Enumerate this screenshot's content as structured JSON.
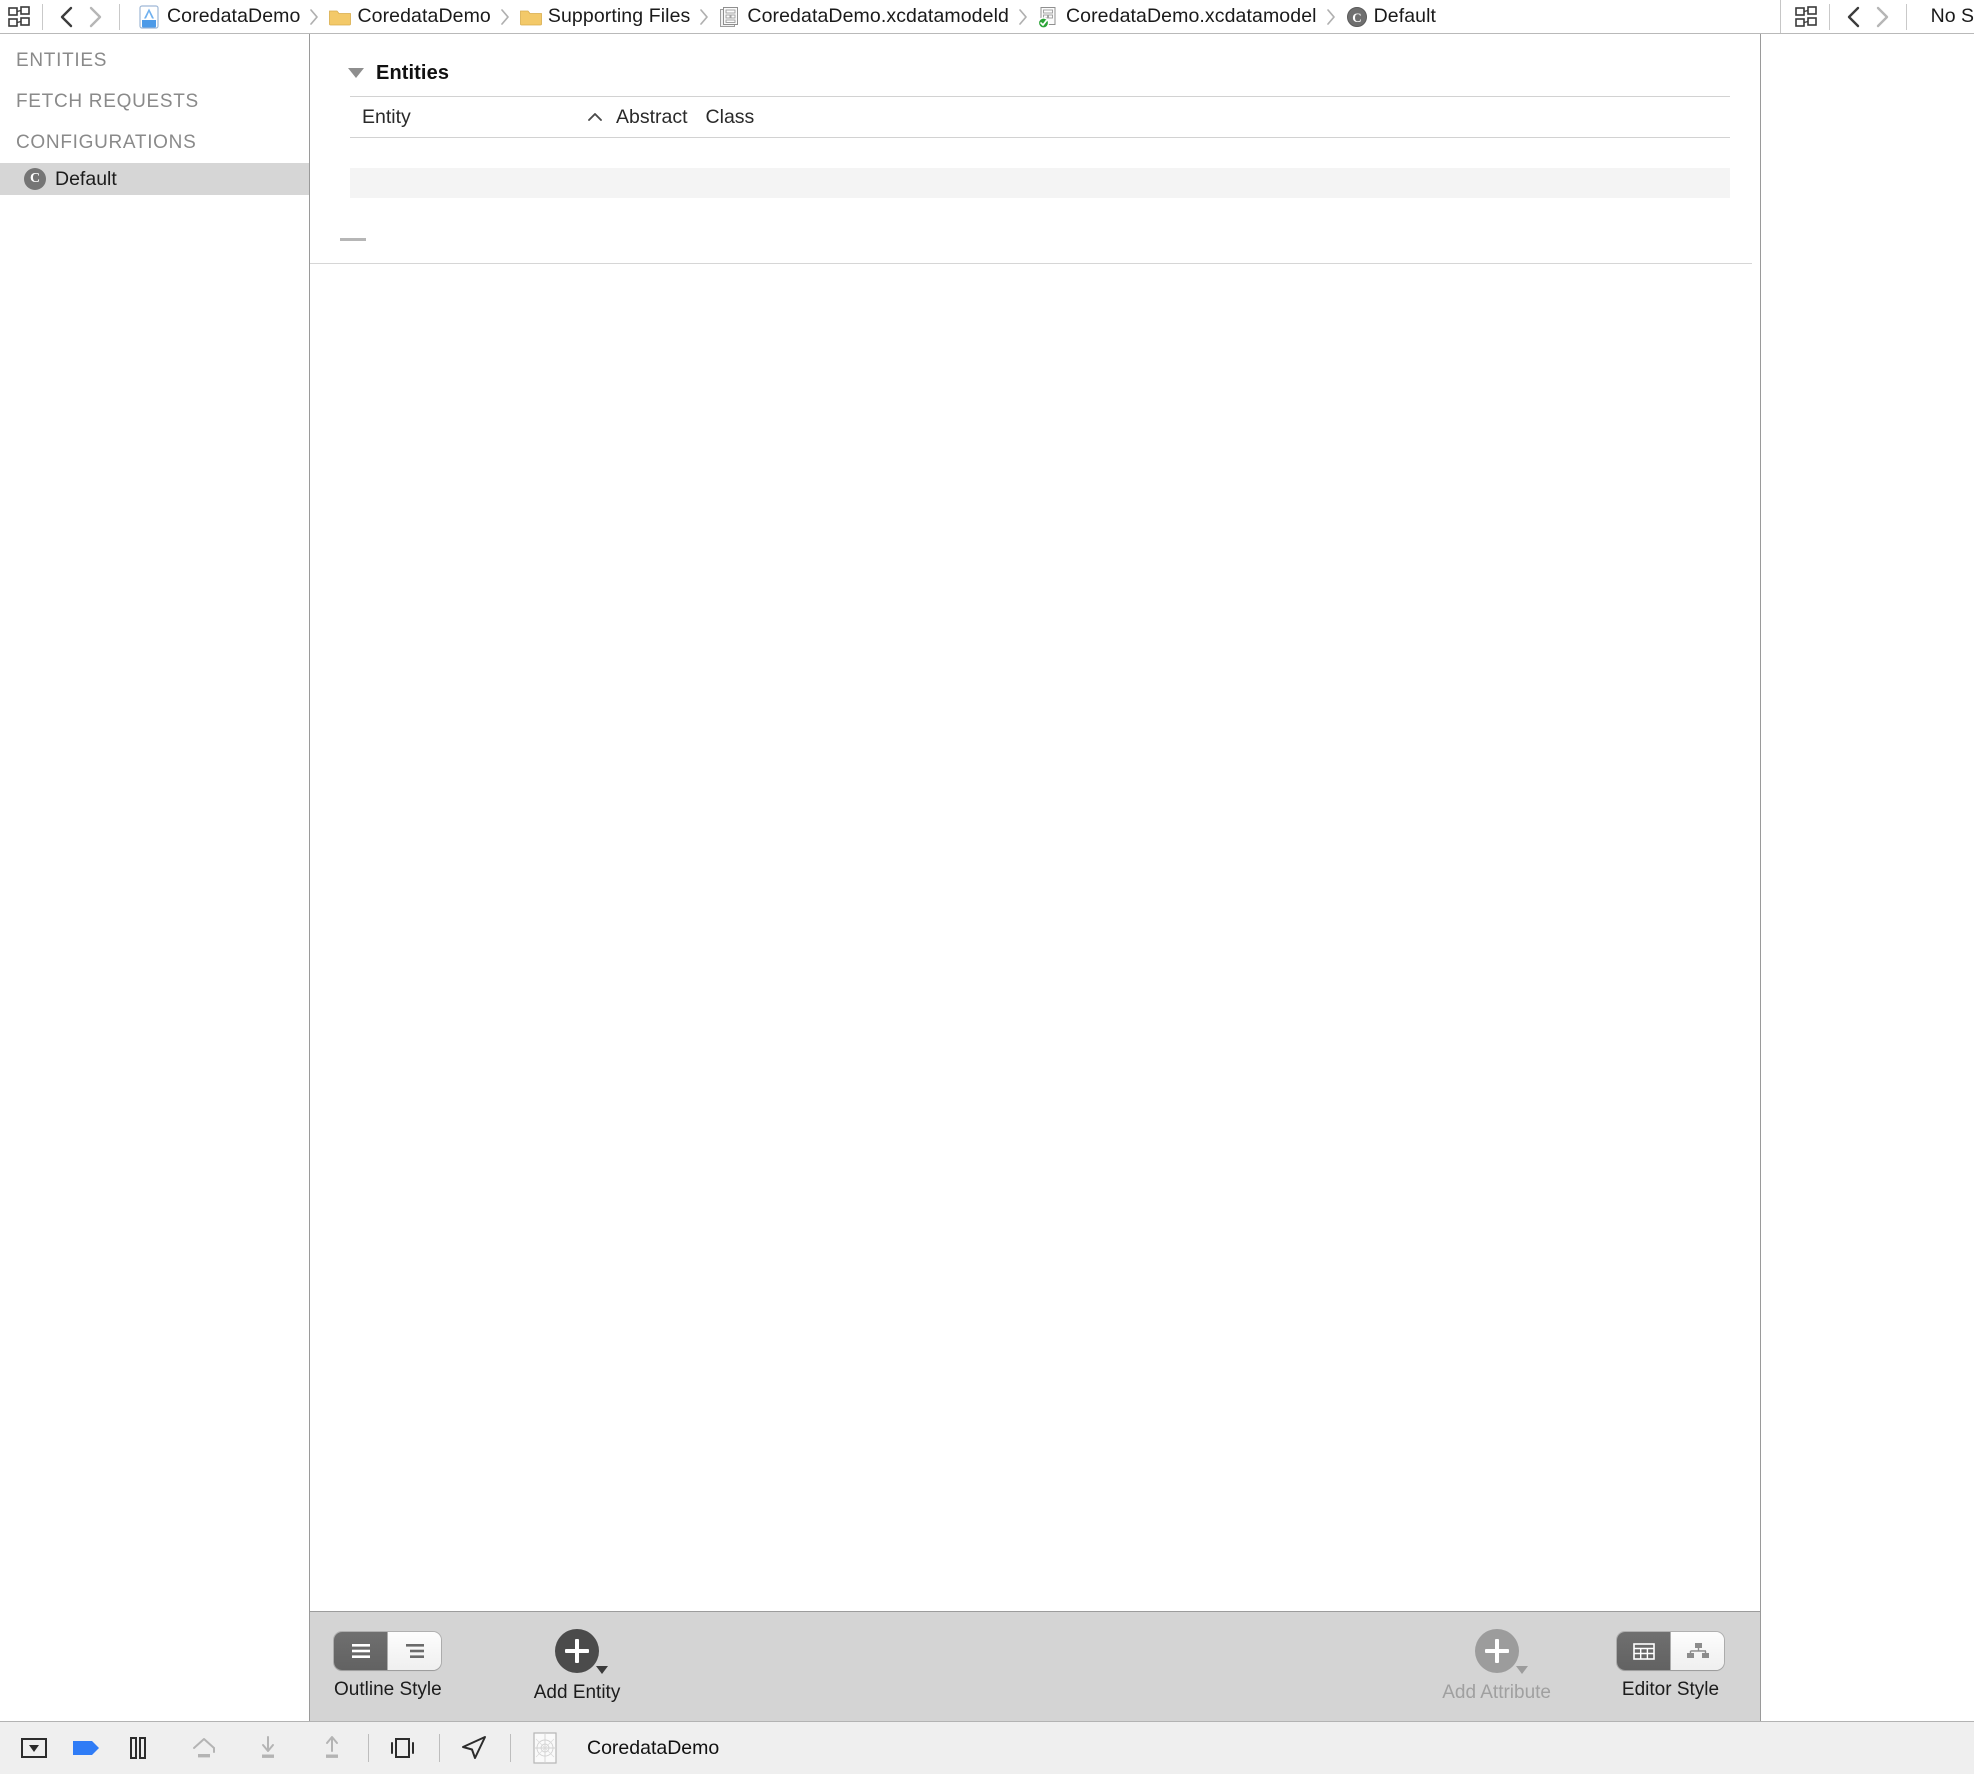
{
  "jumpbar": {
    "related_items_icon": "related-items-icon",
    "back_icon": "chevron-left-icon",
    "forward_icon": "chevron-right-icon",
    "breadcrumbs": [
      {
        "label": "CoredataDemo",
        "icon": "xcode-project-icon"
      },
      {
        "label": "CoredataDemo",
        "icon": "folder-icon"
      },
      {
        "label": "Supporting Files",
        "icon": "folder-icon"
      },
      {
        "label": "CoredataDemo.xcdatamodeld",
        "icon": "datamodeld-icon"
      },
      {
        "label": "CoredataDemo.xcdatamodel",
        "icon": "datamodel-checked-icon"
      },
      {
        "label": "Default",
        "icon": "configuration-icon"
      }
    ],
    "assistant": {
      "related_items_icon": "related-items-icon",
      "back_icon": "chevron-left-icon",
      "forward_icon": "chevron-right-icon",
      "status_text": "No S"
    }
  },
  "outline": {
    "sections": [
      {
        "title": "ENTITIES",
        "items": []
      },
      {
        "title": "FETCH REQUESTS",
        "items": []
      },
      {
        "title": "CONFIGURATIONS",
        "items": [
          {
            "label": "Default",
            "badge": "C",
            "selected": true
          }
        ]
      }
    ]
  },
  "editor": {
    "group": {
      "title": "Entities",
      "disclosure_icon": "disclosure-triangle-down-icon",
      "expanded": true
    },
    "table": {
      "columns": [
        {
          "key": "entity",
          "label": "Entity",
          "sorted": true,
          "sort_icon": "sort-ascending-caret-icon"
        },
        {
          "key": "abstract",
          "label": "Abstract"
        },
        {
          "key": "class",
          "label": "Class"
        }
      ],
      "rows": []
    }
  },
  "editor_toolbar": {
    "outline_style": {
      "label": "Outline Style",
      "options": [
        {
          "name": "flat-list-icon",
          "selected": true
        },
        {
          "name": "hierarchical-list-icon",
          "selected": false
        }
      ]
    },
    "add_entity": {
      "label": "Add Entity",
      "icon": "plus-circle-icon",
      "has_menu": true,
      "disabled": false
    },
    "add_attribute": {
      "label": "Add Attribute",
      "icon": "plus-circle-icon",
      "has_menu": true,
      "disabled": true
    },
    "editor_style": {
      "label": "Editor Style",
      "options": [
        {
          "name": "table-editor-icon",
          "selected": true
        },
        {
          "name": "graph-editor-icon",
          "selected": false
        }
      ]
    }
  },
  "debugbar": {
    "buttons": [
      {
        "name": "hide-debug-area-icon",
        "enabled": true
      },
      {
        "name": "activate-breakpoints-icon",
        "enabled": true
      },
      {
        "name": "pause-icon",
        "enabled": true
      },
      {
        "name": "step-over-icon",
        "enabled": false
      },
      {
        "name": "step-into-icon",
        "enabled": false
      },
      {
        "name": "step-out-icon",
        "enabled": false
      },
      {
        "name": "view-hierarchy-icon",
        "enabled": true
      },
      {
        "name": "simulate-location-icon",
        "enabled": true
      }
    ],
    "process": {
      "icon": "process-thumbnail-icon",
      "label": "CoredataDemo"
    }
  },
  "colors": {
    "selection_gray": "#d6d6d6",
    "toolbar_gray": "#d4d4d4",
    "statusbar_gray": "#efefef",
    "breakpoint_blue": "#2f7cf6",
    "segment_on": "#676767",
    "folder_yellow": "#f3c969",
    "check_green": "#2aa336",
    "disabled_gray": "#a0a0a0"
  }
}
